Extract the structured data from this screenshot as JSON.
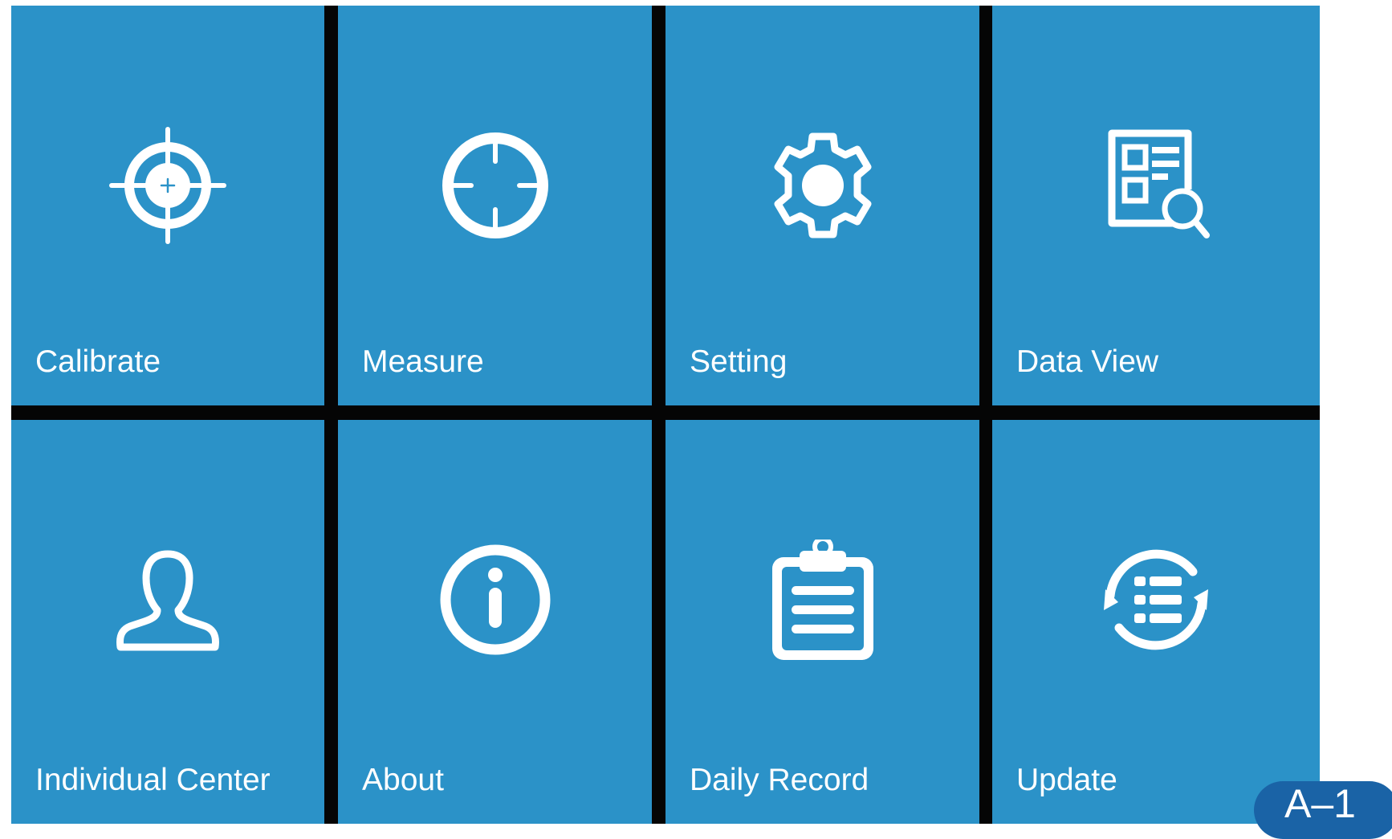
{
  "menu": {
    "calibrate": {
      "label": "Calibrate",
      "icon": "crosshair-target-icon"
    },
    "measure": {
      "label": "Measure",
      "icon": "reticle-icon"
    },
    "setting": {
      "label": "Setting",
      "icon": "gear-icon"
    },
    "data_view": {
      "label": "Data View",
      "icon": "document-search-icon"
    },
    "individual_center": {
      "label": "Individual Center",
      "icon": "user-icon"
    },
    "about": {
      "label": "About",
      "icon": "info-icon"
    },
    "daily_record": {
      "label": "Daily Record",
      "icon": "clipboard-icon"
    },
    "update": {
      "label": "Update",
      "icon": "sync-list-icon"
    }
  },
  "figure_label": "A–1",
  "colors": {
    "tile": "#2b92c8",
    "grid_gap": "#050505",
    "icon": "#ffffff",
    "badge": "#1a63a6"
  }
}
